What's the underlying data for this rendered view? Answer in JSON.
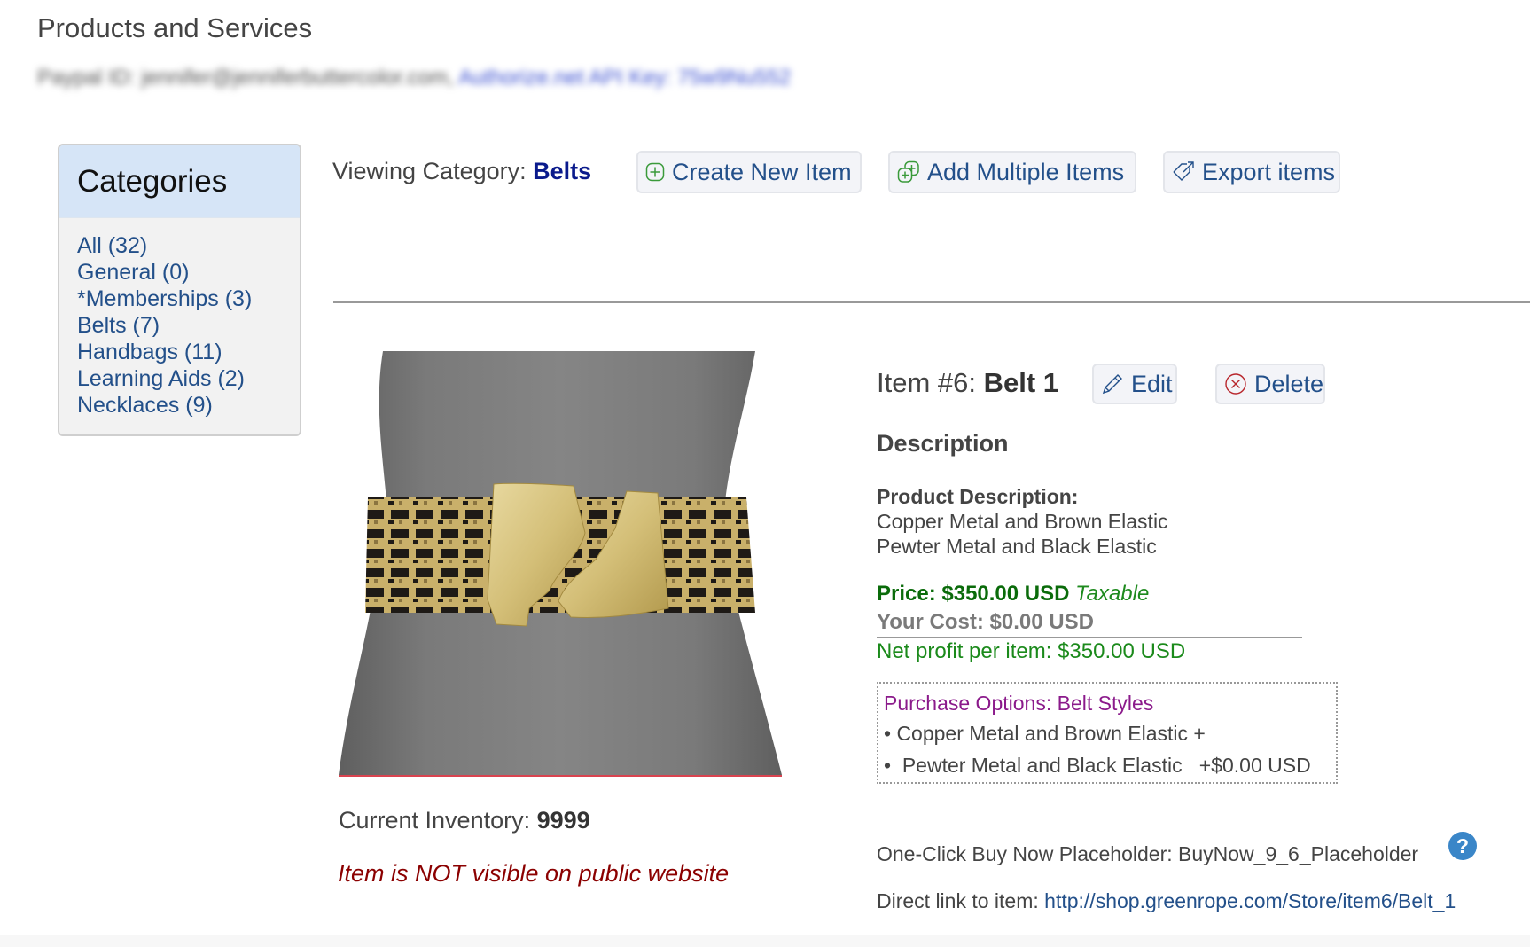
{
  "header": {
    "title": "Products and Services",
    "account_info_blurred": "Paypal ID: jennifer@jenniferbuttercolor.com,",
    "api_key_blurred": "Authorize.net API Key: 75w9Nu552"
  },
  "categories": {
    "title": "Categories",
    "items": [
      {
        "label": "All (32)"
      },
      {
        "label": "General (0)"
      },
      {
        "label": "*Memberships (3)"
      },
      {
        "label": "Belts (7)"
      },
      {
        "label": "Handbags (11)"
      },
      {
        "label": "Learning Aids (2)"
      },
      {
        "label": "Necklaces (9)"
      }
    ]
  },
  "toolbar": {
    "viewing_label": "Viewing Category:",
    "viewing_value": "Belts",
    "create_label": "Create New Item",
    "multi_label": "Add Multiple Items",
    "export_label": "Export items"
  },
  "item": {
    "title_prefix": "Item #6:",
    "name": "Belt 1",
    "edit_label": "Edit",
    "delete_label": "Delete",
    "description_heading": "Description",
    "product_description_label": "Product Description:",
    "description_lines": [
      "Copper Metal and Brown Elastic",
      "Pewter Metal and Black Elastic"
    ],
    "price_label": "Price: $350.00 USD",
    "taxable": "Taxable",
    "cost_label": "Your Cost: $0.00 USD",
    "profit_label": "Net profit per item: $350.00 USD",
    "purchase_options": {
      "title": "Purchase Options: Belt Styles",
      "options": [
        {
          "label": "• Copper Metal and Brown Elastic +"
        },
        {
          "label": "•  Pewter Metal and Black Elastic   +$0.00 USD"
        }
      ]
    },
    "buynow_label": "One-Click Buy Now Placeholder: BuyNow_9_6_Placeholder",
    "help_icon": "?",
    "direct_link_label": "Direct link to item:",
    "direct_link_url": "http://shop.greenrope.com/Store/item6/Belt_1",
    "inventory_label": "Current Inventory:",
    "inventory_value": "9999",
    "visibility_notice": "Item is NOT visible on public website"
  },
  "colors": {
    "link_blue": "#23508a",
    "category_header_bg": "#d6e5f7",
    "price_green": "#0a6b0a",
    "options_purple": "#8b1a8b",
    "warning_red": "#8b0000",
    "help_blue": "#3a86c8"
  }
}
